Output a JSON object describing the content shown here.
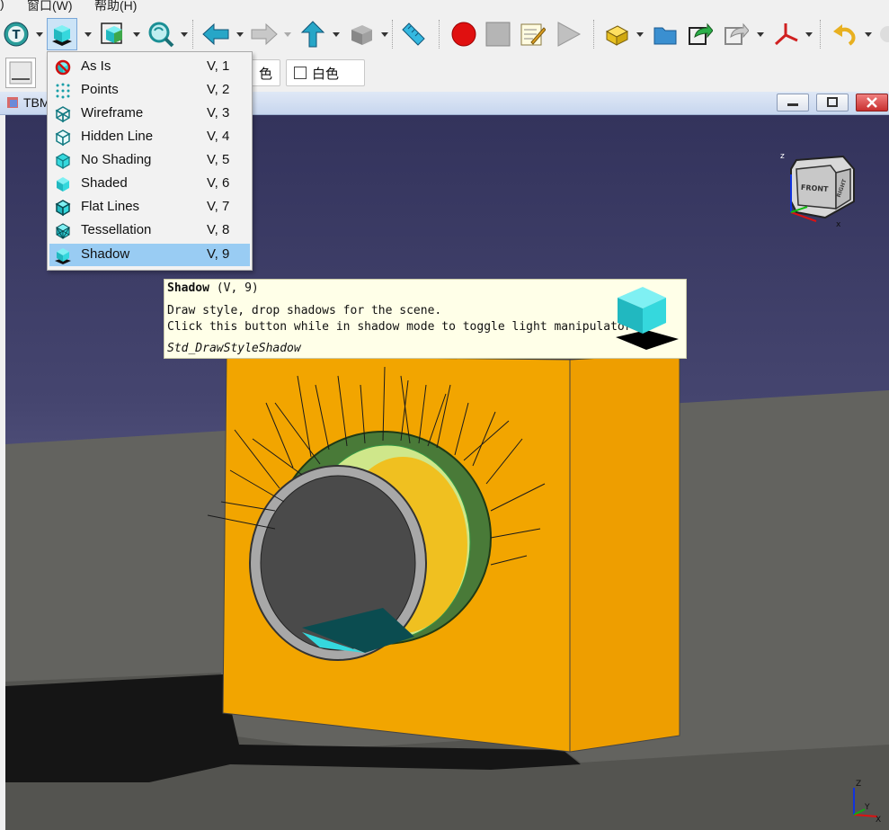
{
  "menubar": {
    "items": [
      {
        "label": ")"
      },
      {
        "label": "窗口(W)"
      },
      {
        "label": "帮助(H)"
      }
    ]
  },
  "toolbar2": {
    "color_left_label": "色",
    "color_white_label": "白色"
  },
  "mdi": {
    "tab_title": "TBM"
  },
  "draw_style_menu": {
    "items": [
      {
        "icon": "as-is-icon",
        "label": "As Is",
        "shortcut": "V, 1"
      },
      {
        "icon": "points-icon",
        "label": "Points",
        "shortcut": "V, 2"
      },
      {
        "icon": "wireframe-icon",
        "label": "Wireframe",
        "shortcut": "V, 3"
      },
      {
        "icon": "hidden-line-icon",
        "label": "Hidden Line",
        "shortcut": "V, 4"
      },
      {
        "icon": "no-shading-icon",
        "label": "No Shading",
        "shortcut": "V, 5"
      },
      {
        "icon": "shaded-icon",
        "label": "Shaded",
        "shortcut": "V, 6"
      },
      {
        "icon": "flat-lines-icon",
        "label": "Flat Lines",
        "shortcut": "V, 7"
      },
      {
        "icon": "tessellation-icon",
        "label": "Tessellation",
        "shortcut": "V, 8"
      },
      {
        "icon": "shadow-icon",
        "label": "Shadow",
        "shortcut": "V, 9",
        "selected": true
      }
    ]
  },
  "tooltip": {
    "title": "Shadow",
    "shortcut": "(V, 9)",
    "line1": "Draw style, drop shadows for the scene.",
    "line2": "Click this button while in shadow mode to toggle light manipulator",
    "command": "Std_DrawStyleShadow"
  },
  "navcube": {
    "face_label": "FRONT",
    "side_label": "RIGHT",
    "axis_z": "z",
    "axis_x": "x"
  },
  "axis_corner": {
    "z": "Z",
    "y": "Y",
    "x": "X"
  },
  "colors": {
    "block": "#f0a000",
    "viewport_top": "#33335c",
    "viewport_bottom": "#7e7ea6",
    "ground": "#62625f",
    "menu_selected": "#99ccf3",
    "accent_cyan": "#35d8dd"
  }
}
